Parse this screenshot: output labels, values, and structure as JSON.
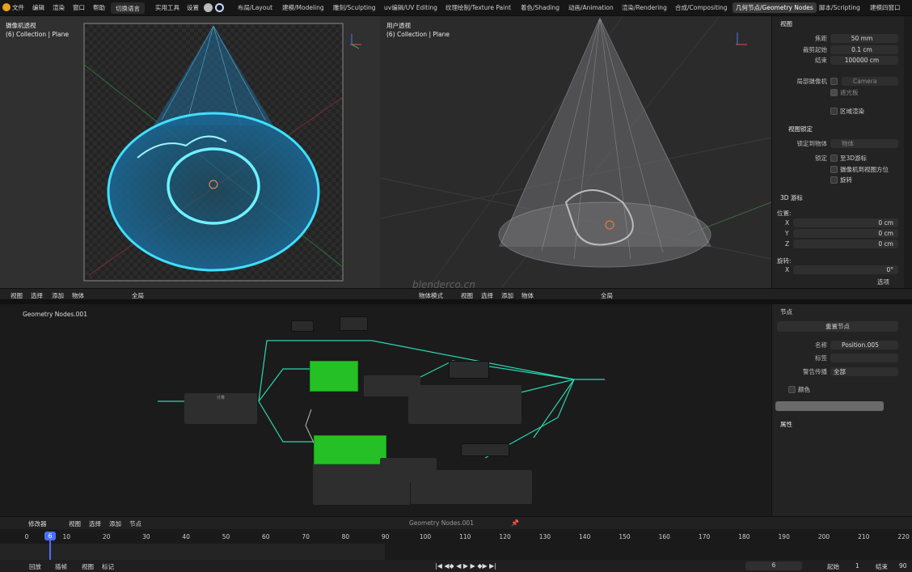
{
  "menu": {
    "items": [
      "文件",
      "编辑",
      "渲染",
      "窗口",
      "帮助"
    ],
    "lang_btn": "切换语言",
    "tools": "实用工具",
    "settings": "设置"
  },
  "workspaces": [
    "布局/Layout",
    "建模/Modeling",
    "雕刻/Sculpting",
    "uv编辑/UV Editing",
    "纹理绘制/Texture Paint",
    "着色/Shading",
    "动画/Animation",
    "渲染/Rendering",
    "合成/Compositing",
    "几何节点/Geometry Nodes",
    "脚本/Scripting",
    "建模四窗口"
  ],
  "active_workspace": "几何节点/Geometry Nodes",
  "viewport_left": {
    "title": "摄像机透视",
    "subtitle": "(6) Collection | Plane"
  },
  "viewport_right": {
    "title": "用户透视",
    "subtitle": "(6) Collection | Plane"
  },
  "view_header_left": {
    "view": "视图",
    "select": "选择",
    "add": "添加",
    "object": "物体",
    "global": "全局"
  },
  "view_header_right": {
    "mode": "物体模式",
    "view": "视图",
    "select": "选择",
    "add": "添加",
    "object": "物体",
    "global": "全局"
  },
  "watermark": "blenderco.cn",
  "props": {
    "section_view": "视图",
    "focal_label": "焦距",
    "focal_value": "50 mm",
    "clip_start_label": "裁剪起始",
    "clip_start_value": "0.1 cm",
    "clip_end_label": "结束",
    "clip_end_value": "100000 cm",
    "local_cam_label": "局部摄像机",
    "camera_value": "Camera",
    "cursor_label": "遮光板",
    "region_render": "区域渲染",
    "section_view_lock": "视图锁定",
    "lock_obj_label": "锁定到物体",
    "lock_obj_value": "物体",
    "lock_label": "锁定",
    "lock_3d_cursor": "至3D游标",
    "lock_cam_to_view": "摄像机到视图方位",
    "lock_rotation": "旋转",
    "section_3d_cursor": "3D 游标",
    "location_label": "位置:",
    "x_label": "X",
    "x_value": "0 cm",
    "y_label": "Y",
    "y_value": "0 cm",
    "z_label": "Z",
    "z_value": "0 cm",
    "rotation_label": "旋转:",
    "rx_label": "X",
    "rx_value": "0°",
    "options": "选项"
  },
  "node_editor": {
    "title": "Geometry Nodes.001",
    "frame_label": "计算"
  },
  "node_panel": {
    "section_node": "节点",
    "reset_btn": "重置节点",
    "name_label": "名称",
    "name_value": "Position.005",
    "label_label": "标签",
    "warn_label": "警告传播",
    "warn_value": "全部",
    "color_label": "颜色",
    "attr_label": "属性"
  },
  "node_header": {
    "modifier": "修改器",
    "view": "视图",
    "select": "选择",
    "add": "添加",
    "node": "节点",
    "tree_name": "Geometry Nodes.001"
  },
  "timeline": {
    "current_frame": "6",
    "ticks": [
      "0",
      "10",
      "20",
      "30",
      "40",
      "50",
      "60",
      "70",
      "80",
      "90",
      "100",
      "110",
      "120",
      "130",
      "140",
      "150",
      "160",
      "170",
      "180",
      "190",
      "200",
      "210",
      "220"
    ]
  },
  "bottom": {
    "playback": "回放",
    "keying": "插帧",
    "view": "视图",
    "marker": "标记",
    "frame": "6",
    "start_label": "起始",
    "start_value": "1",
    "end_label": "结束",
    "end_value": "90"
  }
}
